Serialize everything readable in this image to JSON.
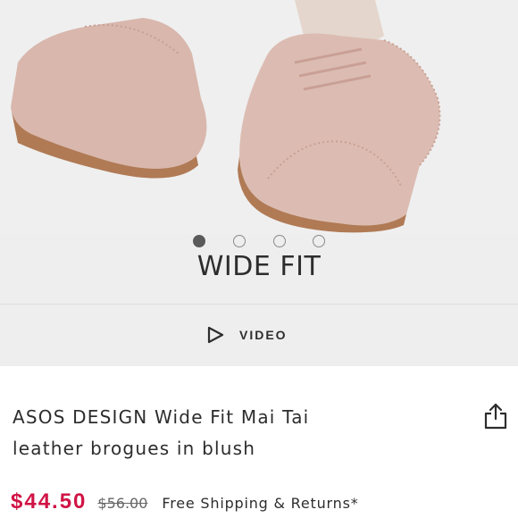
{
  "gallery": {
    "caption": "WIDE FIT",
    "slide_count": 4,
    "active_slide": 1,
    "image_subject": "blush pink suede wingtip brogue shoes",
    "colors": {
      "background": "#eeeeee",
      "shoe": "#d9b7ad",
      "sole": "#b07a55"
    }
  },
  "video": {
    "label": "VIDEO",
    "icon": "play-icon"
  },
  "product": {
    "title_line1": "ASOS DESIGN Wide Fit Mai Tai",
    "title_line2": "leather brogues in blush",
    "share_icon": "share-icon"
  },
  "pricing": {
    "current": "$44.50",
    "original": "$56.00",
    "shipping": "Free Shipping & Returns*",
    "accent_color": "#d01345"
  }
}
